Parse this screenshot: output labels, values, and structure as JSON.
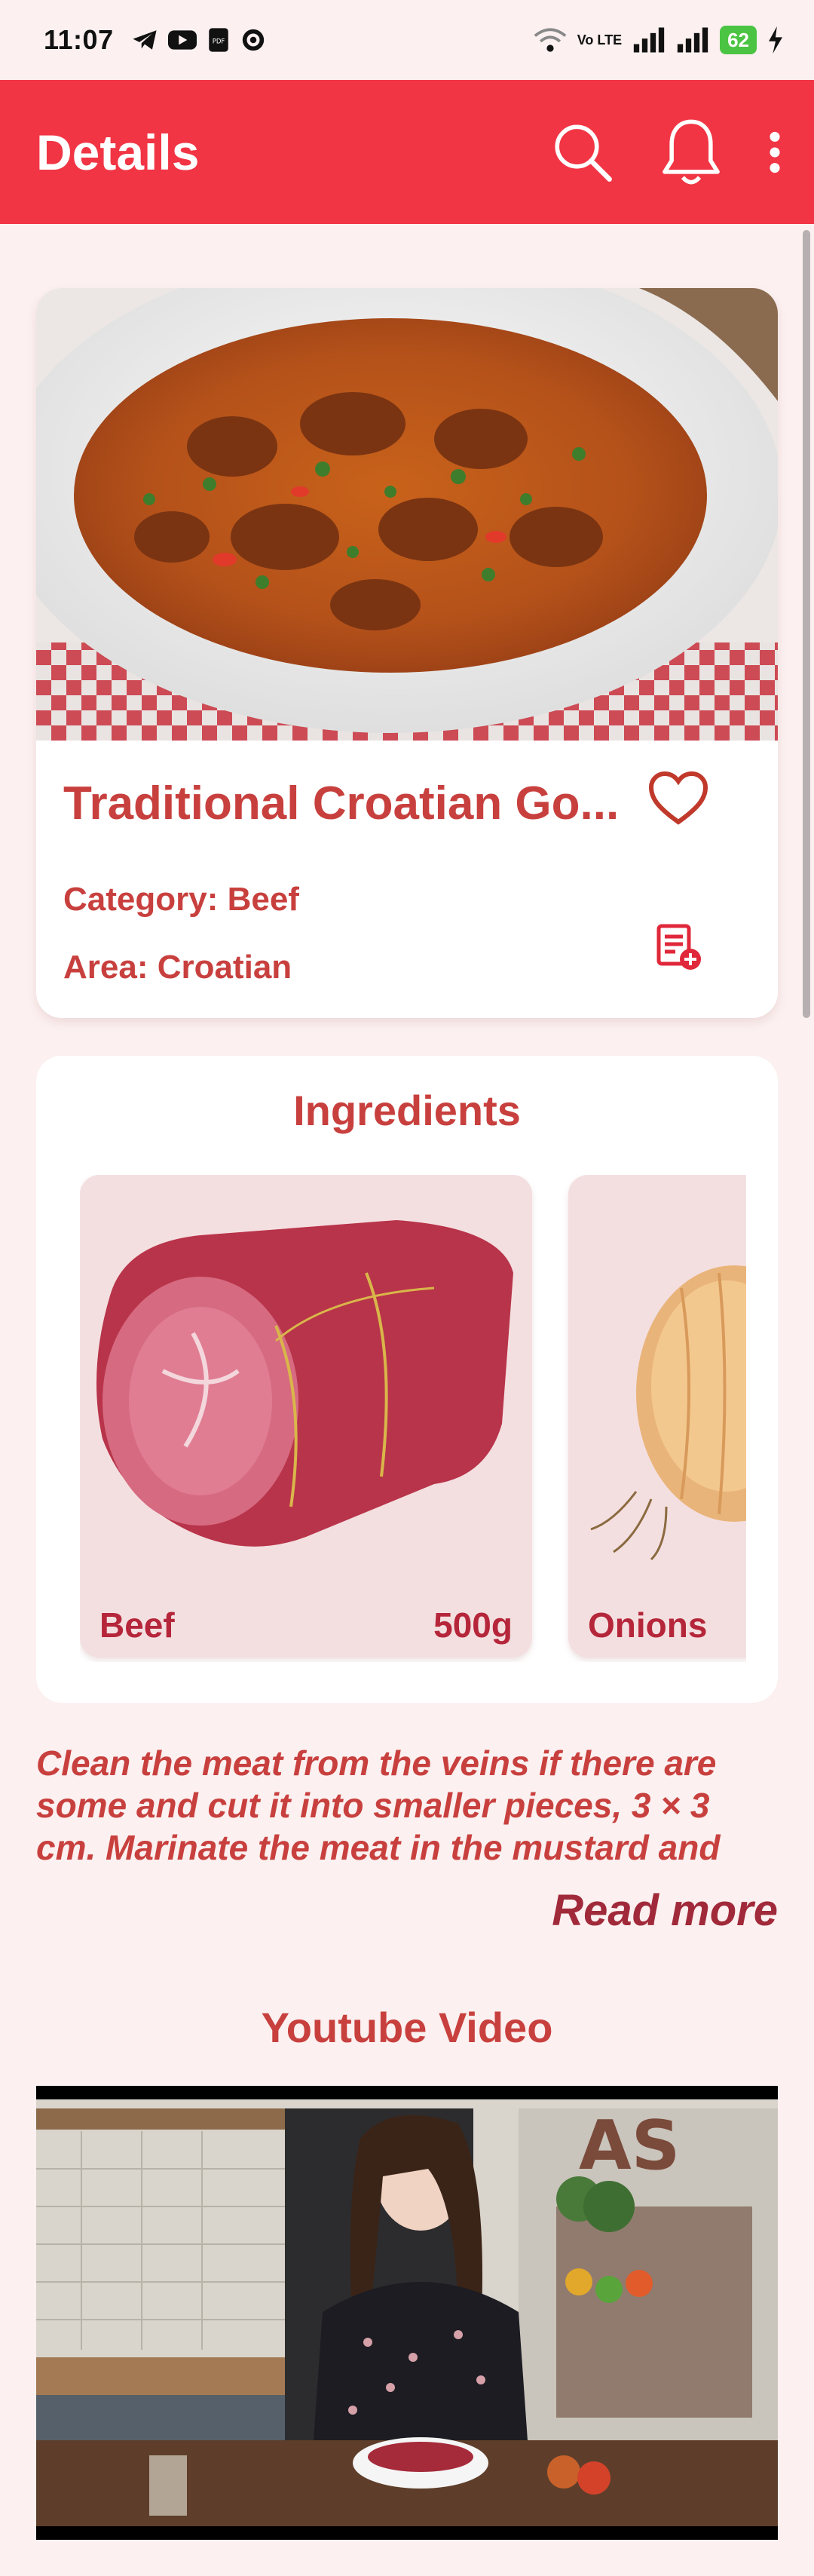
{
  "status_bar": {
    "time": "11:07",
    "battery": "62",
    "network": "Vo LTE",
    "icons": [
      "telegram-icon",
      "youtube-icon",
      "pdf-icon",
      "whatsapp-icon",
      "wifi-icon",
      "signal-icon",
      "charging-icon"
    ]
  },
  "app_bar": {
    "title": "Details",
    "actions": [
      "search-icon",
      "bell-icon",
      "more-vert-icon"
    ]
  },
  "recipe": {
    "title": "Traditional Croatian Go...",
    "category_label": "Category: Beef",
    "area_label": "Area: Croatian",
    "favorite_icon": "heart-outline-icon",
    "add_icon": "add-to-list-icon"
  },
  "ingredients": {
    "title": "Ingredients",
    "items": [
      {
        "name": "Beef",
        "measure": "500g"
      },
      {
        "name": "Onions",
        "measure": ""
      }
    ]
  },
  "instructions": {
    "text": "Clean the meat from the veins if there are some and cut it into smaller pieces, 3 × 3 cm. Marinate the meat in the mustard and",
    "read_more": "Read more"
  },
  "video": {
    "title": "Youtube Video"
  },
  "colors": {
    "accent": "#f13544",
    "text_red": "#c8403e",
    "background": "#fcf0f0"
  }
}
